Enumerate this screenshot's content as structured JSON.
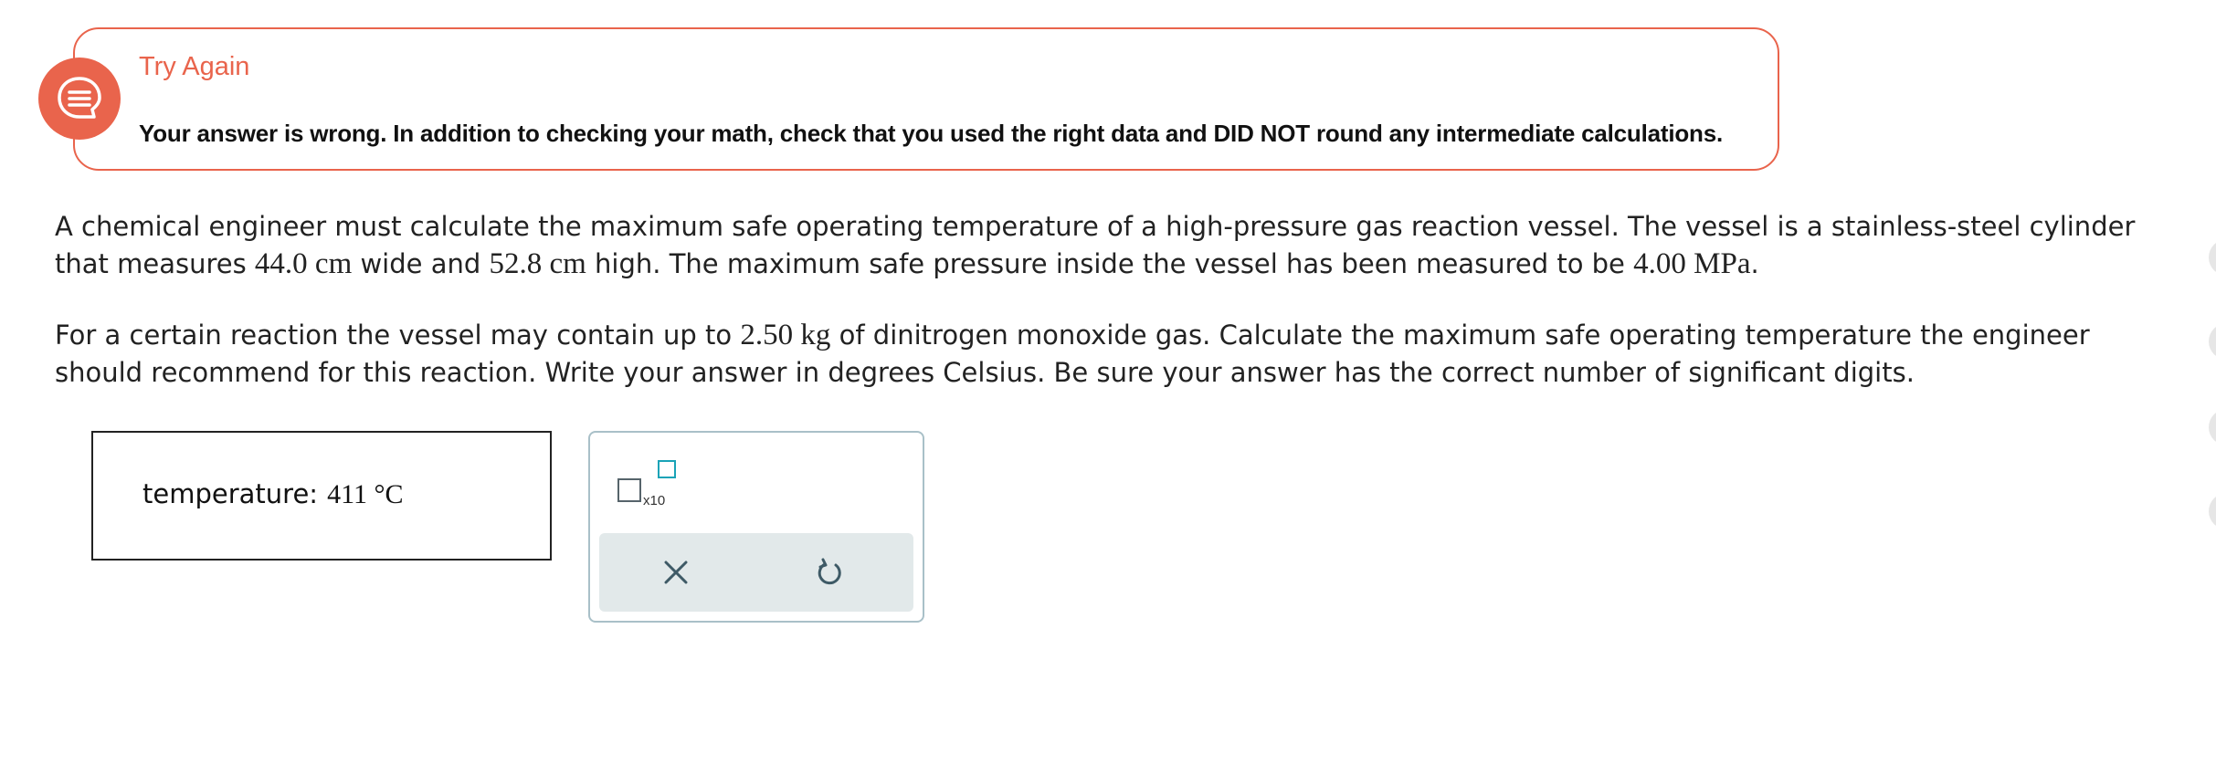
{
  "feedback": {
    "title": "Try Again",
    "message": "Your answer is wrong. In addition to checking your math, check that you used the right data and DID NOT round any intermediate calculations.",
    "accent_color": "#e9644c",
    "icon": "chat-bubble-icon"
  },
  "problem": {
    "p1_a": "A chemical engineer must calculate the maximum safe operating temperature of a high-pressure gas reaction vessel. The vessel is a stainless-steel cylinder that measures ",
    "width_value": "44.0 cm",
    "p1_b": " wide and ",
    "height_value": "52.8 cm",
    "p1_c": " high. The maximum safe pressure inside the vessel has been measured to be ",
    "pressure_value": "4.00 MPa",
    "p1_d": ".",
    "p2_a": "For a certain reaction the vessel may contain up to ",
    "mass_value": "2.50 kg",
    "p2_b": " of dinitrogen monoxide gas. Calculate the maximum safe operating temperature the engineer should recommend for this reaction. Write your answer in degrees Celsius. Be sure your answer has the correct number of significant digits."
  },
  "answer": {
    "label": "temperature:",
    "value": "411 °C"
  },
  "palette": {
    "sci_label": "x10",
    "clear_icon": "close-icon",
    "undo_icon": "undo-icon"
  }
}
